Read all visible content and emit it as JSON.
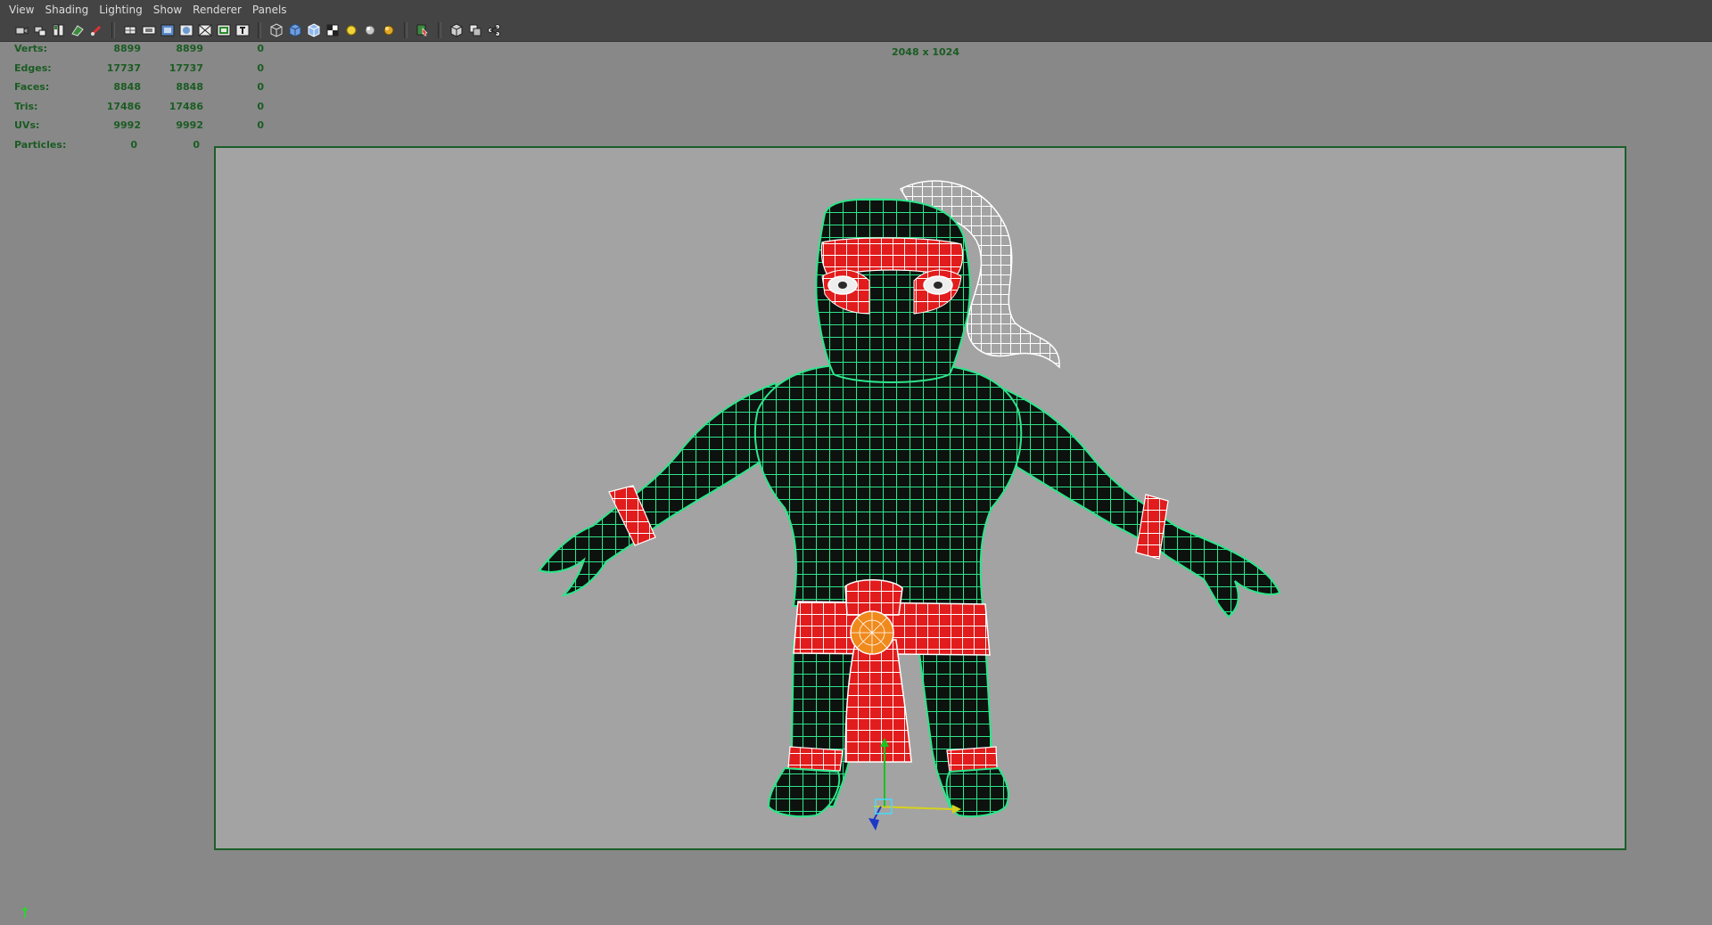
{
  "menu": [
    "View",
    "Shading",
    "Lighting",
    "Show",
    "Renderer",
    "Panels"
  ],
  "toolbar_icons": [
    "camera-icon",
    "camera-attributes-icon",
    "bookmark-icon",
    "image-plane-icon",
    "grease-pencil-icon",
    "grid-icon",
    "film-gate-icon",
    "resolution-gate-icon",
    "gate-mask-icon",
    "field-chart-icon",
    "safe-action-icon",
    "safe-title-icon",
    "wireframe-icon",
    "smooth-shade-icon",
    "wireframe-on-shaded-icon",
    "textured-icon",
    "default-lighting-icon",
    "all-lights-icon",
    "shadows-icon",
    "xray-icon",
    "isolate-select-icon",
    "xray-joints-icon",
    "ambient-occlusion-icon"
  ],
  "hud": [
    {
      "label": "Verts:",
      "c1": "8899",
      "c2": "8899",
      "c3": "0"
    },
    {
      "label": "Edges:",
      "c1": "17737",
      "c2": "17737",
      "c3": "0"
    },
    {
      "label": "Faces:",
      "c1": "8848",
      "c2": "8848",
      "c3": "0"
    },
    {
      "label": "Tris:",
      "c1": "17486",
      "c2": "17486",
      "c3": "0"
    },
    {
      "label": "UVs:",
      "c1": "9992",
      "c2": "9992",
      "c3": "0"
    },
    {
      "label": "Particles:",
      "c1": "",
      "c2": "0",
      "c3": "0"
    }
  ],
  "resolution_label": "2048 x 1024",
  "colors": {
    "wire_green": "#2ee58a",
    "body_dark": "#0d120f",
    "cloth_red": "#e21c1c",
    "wire_white": "#ffffff",
    "emblem_orange": "#f08a1c",
    "hud_text": "#1a5c22",
    "viewport_bg": "#888888",
    "gate_bg": "#a3a3a3"
  }
}
